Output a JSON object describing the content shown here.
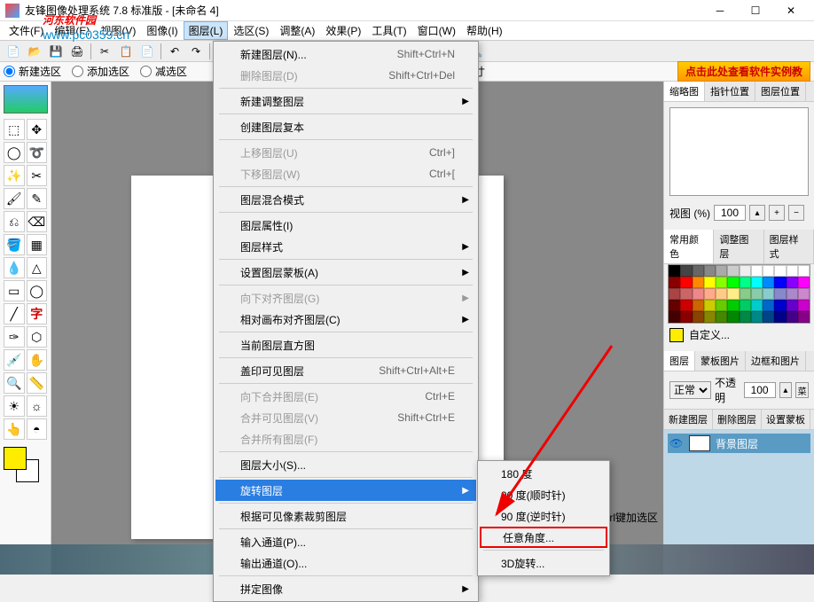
{
  "title": "友锋图像处理系统 7.8 标准版 - [未命名 4]",
  "watermark_text": "河东软件园",
  "watermark_url": "www.pc0359.cn",
  "menubar": [
    "文件(F)",
    "编辑(E)",
    "视图(V)",
    "图像(I)",
    "图层(L)",
    "选区(S)",
    "调整(A)",
    "效果(P)",
    "工具(T)",
    "窗口(W)",
    "帮助(H)"
  ],
  "menubar_active_index": 4,
  "sel_bar": {
    "new_sel": "新建选区",
    "add_sel": "添加选区",
    "sub_sel": "减选区",
    "size_label": "尺寸",
    "promo": "点击此处查看软件实例教"
  },
  "dropdown": {
    "items": [
      {
        "label": "新建图层(N)...",
        "shortcut": "Shift+Ctrl+N",
        "enabled": true,
        "arrow": false
      },
      {
        "label": "删除图层(D)",
        "shortcut": "Shift+Ctrl+Del",
        "enabled": false,
        "arrow": false
      },
      {
        "sep": true
      },
      {
        "label": "新建调整图层",
        "shortcut": "",
        "enabled": true,
        "arrow": true
      },
      {
        "sep": true
      },
      {
        "label": "创建图层复本",
        "shortcut": "",
        "enabled": true,
        "arrow": false
      },
      {
        "sep": true
      },
      {
        "label": "上移图层(U)",
        "shortcut": "Ctrl+]",
        "enabled": false,
        "arrow": false
      },
      {
        "label": "下移图层(W)",
        "shortcut": "Ctrl+[",
        "enabled": false,
        "arrow": false
      },
      {
        "sep": true
      },
      {
        "label": "图层混合模式",
        "shortcut": "",
        "enabled": true,
        "arrow": true
      },
      {
        "sep": true
      },
      {
        "label": "图层属性(I)",
        "shortcut": "",
        "enabled": true,
        "arrow": false
      },
      {
        "label": "图层样式",
        "shortcut": "",
        "enabled": true,
        "arrow": true
      },
      {
        "sep": true
      },
      {
        "label": "设置图层蒙板(A)",
        "shortcut": "",
        "enabled": true,
        "arrow": true
      },
      {
        "sep": true
      },
      {
        "label": "向下对齐图层(G)",
        "shortcut": "",
        "enabled": false,
        "arrow": true
      },
      {
        "label": "相对画布对齐图层(C)",
        "shortcut": "",
        "enabled": true,
        "arrow": true
      },
      {
        "sep": true
      },
      {
        "label": "当前图层直方图",
        "shortcut": "",
        "enabled": true,
        "arrow": false
      },
      {
        "sep": true
      },
      {
        "label": "盖印可见图层",
        "shortcut": "Shift+Ctrl+Alt+E",
        "enabled": true,
        "arrow": false
      },
      {
        "sep": true
      },
      {
        "label": "向下合并图层(E)",
        "shortcut": "Ctrl+E",
        "enabled": false,
        "arrow": false
      },
      {
        "label": "合并可见图层(V)",
        "shortcut": "Shift+Ctrl+E",
        "enabled": false,
        "arrow": false
      },
      {
        "label": "合并所有图层(F)",
        "shortcut": "",
        "enabled": false,
        "arrow": false
      },
      {
        "sep": true
      },
      {
        "label": "图层大小(S)...",
        "shortcut": "",
        "enabled": true,
        "arrow": false
      },
      {
        "sep": true
      },
      {
        "label": "旋转图层",
        "shortcut": "",
        "enabled": true,
        "arrow": true,
        "highlighted": true
      },
      {
        "sep": true
      },
      {
        "label": "根据可见像素裁剪图层",
        "shortcut": "",
        "enabled": true,
        "arrow": false
      },
      {
        "sep": true
      },
      {
        "label": "输入通道(P)...",
        "shortcut": "",
        "enabled": true,
        "arrow": false
      },
      {
        "label": "输出通道(O)...",
        "shortcut": "",
        "enabled": true,
        "arrow": false
      },
      {
        "sep": true
      },
      {
        "label": "拼定图像",
        "shortcut": "",
        "enabled": true,
        "arrow": true
      }
    ]
  },
  "submenu": {
    "items": [
      {
        "label": "180 度",
        "boxed": false
      },
      {
        "label": "90 度(顺时针)",
        "boxed": false
      },
      {
        "label": "90 度(逆时针)",
        "boxed": false
      },
      {
        "label": "任意角度...",
        "boxed": true
      },
      {
        "sep": true
      },
      {
        "label": "3D旋转...",
        "boxed": false
      }
    ]
  },
  "right": {
    "tabs1": [
      "缩略图",
      "指针位置",
      "图层位置"
    ],
    "view_label": "视图 (%)",
    "view_value": "100",
    "tabs2": [
      "常用颜色",
      "调整图层",
      "图层样式"
    ],
    "custom_label": "自定义...",
    "tabs3": [
      "图层",
      "蒙板图片",
      "边框和图片"
    ],
    "blend_mode": "正常",
    "opacity_label": "不透明",
    "opacity_value": "100",
    "menu_btn": "菜",
    "layer_btns": [
      "新建图层",
      "删除图层",
      "设置蒙板"
    ],
    "layer_name": "背景图层"
  },
  "status_hint": "为中心点，Ctrl键加选区",
  "palette_colors": [
    "#000",
    "#444",
    "#666",
    "#888",
    "#aaa",
    "#ccc",
    "#eee",
    "#fff",
    "#fff",
    "#fff",
    "#fff",
    "#fff",
    "#800",
    "#f00",
    "#f80",
    "#ff0",
    "#8f0",
    "#0f0",
    "#0f8",
    "#0ff",
    "#08f",
    "#00f",
    "#80f",
    "#f0f",
    "#a44",
    "#c66",
    "#e88",
    "#fa8",
    "#fc8",
    "#fe8",
    "#8c8",
    "#8ca",
    "#8cc",
    "#88c",
    "#a8c",
    "#c8c",
    "#600",
    "#c00",
    "#c60",
    "#cc0",
    "#6c0",
    "#0c0",
    "#0c6",
    "#0cc",
    "#06c",
    "#00c",
    "#60c",
    "#c0c",
    "#400",
    "#800",
    "#840",
    "#880",
    "#480",
    "#080",
    "#084",
    "#088",
    "#048",
    "#008",
    "#408",
    "#808"
  ]
}
